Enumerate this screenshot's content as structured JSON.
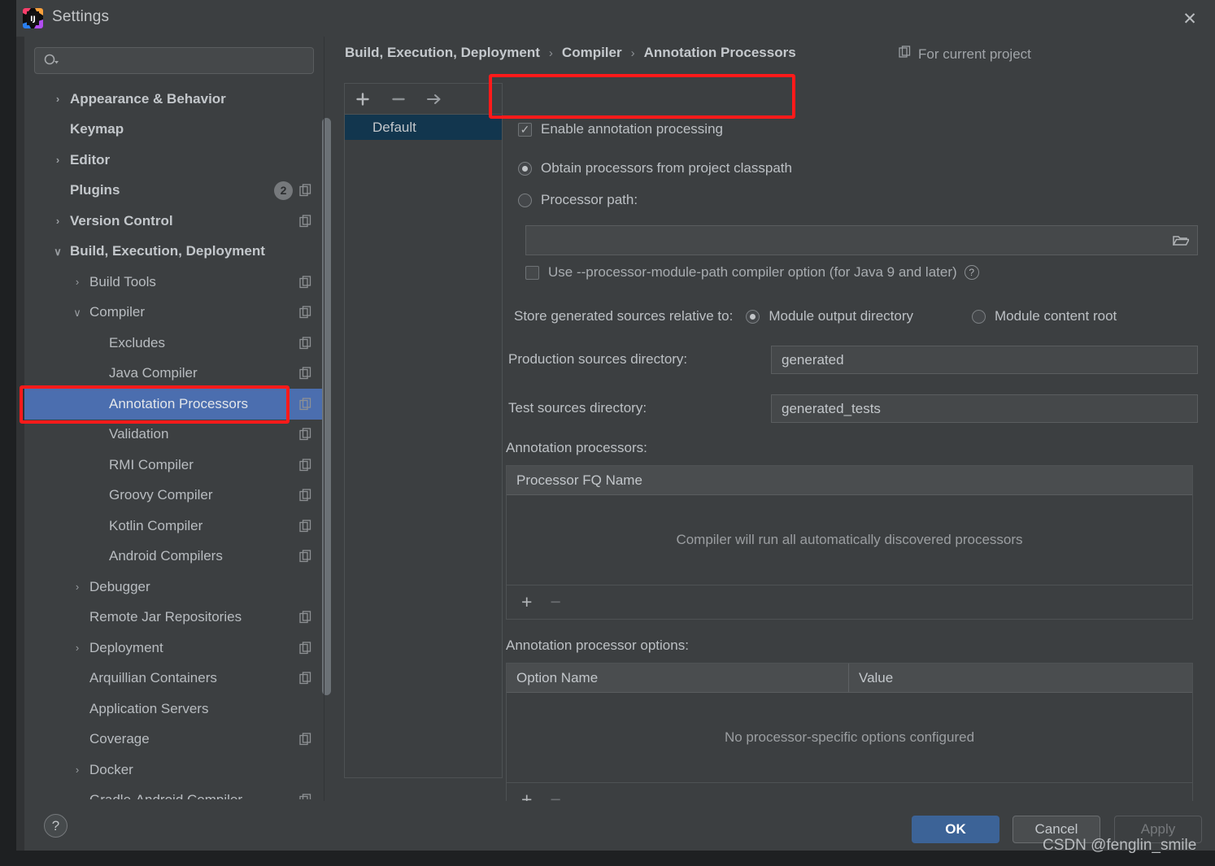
{
  "window": {
    "title": "Settings",
    "close_label": "✕",
    "logo_name": "intellij-idea-logo"
  },
  "search": {
    "placeholder": "",
    "value": ""
  },
  "sidebar": {
    "items": [
      {
        "label": "Appearance & Behavior",
        "indent": 0,
        "twisty": "›",
        "bold": true,
        "copy": false,
        "badge": null
      },
      {
        "label": "Keymap",
        "indent": 0,
        "twisty": "",
        "bold": true,
        "copy": false,
        "badge": null
      },
      {
        "label": "Editor",
        "indent": 0,
        "twisty": "›",
        "bold": true,
        "copy": false,
        "badge": null
      },
      {
        "label": "Plugins",
        "indent": 0,
        "twisty": "",
        "bold": true,
        "copy": true,
        "badge": "2"
      },
      {
        "label": "Version Control",
        "indent": 0,
        "twisty": "›",
        "bold": true,
        "copy": true,
        "badge": null
      },
      {
        "label": "Build, Execution, Deployment",
        "indent": 0,
        "twisty": "∨",
        "bold": true,
        "copy": false,
        "badge": null
      },
      {
        "label": "Build Tools",
        "indent": 1,
        "twisty": "›",
        "bold": false,
        "copy": true,
        "badge": null
      },
      {
        "label": "Compiler",
        "indent": 1,
        "twisty": "∨",
        "bold": false,
        "copy": true,
        "badge": null
      },
      {
        "label": "Excludes",
        "indent": 2,
        "twisty": "",
        "bold": false,
        "copy": true,
        "badge": null
      },
      {
        "label": "Java Compiler",
        "indent": 2,
        "twisty": "",
        "bold": false,
        "copy": true,
        "badge": null
      },
      {
        "label": "Annotation Processors",
        "indent": 2,
        "twisty": "",
        "bold": false,
        "copy": true,
        "badge": null,
        "selected": true
      },
      {
        "label": "Validation",
        "indent": 2,
        "twisty": "",
        "bold": false,
        "copy": true,
        "badge": null
      },
      {
        "label": "RMI Compiler",
        "indent": 2,
        "twisty": "",
        "bold": false,
        "copy": true,
        "badge": null
      },
      {
        "label": "Groovy Compiler",
        "indent": 2,
        "twisty": "",
        "bold": false,
        "copy": true,
        "badge": null
      },
      {
        "label": "Kotlin Compiler",
        "indent": 2,
        "twisty": "",
        "bold": false,
        "copy": true,
        "badge": null
      },
      {
        "label": "Android Compilers",
        "indent": 2,
        "twisty": "",
        "bold": false,
        "copy": true,
        "badge": null
      },
      {
        "label": "Debugger",
        "indent": 1,
        "twisty": "›",
        "bold": false,
        "copy": false,
        "badge": null
      },
      {
        "label": "Remote Jar Repositories",
        "indent": 1,
        "twisty": "",
        "bold": false,
        "copy": true,
        "badge": null
      },
      {
        "label": "Deployment",
        "indent": 1,
        "twisty": "›",
        "bold": false,
        "copy": true,
        "badge": null
      },
      {
        "label": "Arquillian Containers",
        "indent": 1,
        "twisty": "",
        "bold": false,
        "copy": true,
        "badge": null
      },
      {
        "label": "Application Servers",
        "indent": 1,
        "twisty": "",
        "bold": false,
        "copy": false,
        "badge": null
      },
      {
        "label": "Coverage",
        "indent": 1,
        "twisty": "",
        "bold": false,
        "copy": true,
        "badge": null
      },
      {
        "label": "Docker",
        "indent": 1,
        "twisty": "›",
        "bold": false,
        "copy": false,
        "badge": null
      },
      {
        "label": "Gradle-Android Compiler",
        "indent": 1,
        "twisty": "",
        "bold": false,
        "copy": true,
        "badge": null
      }
    ]
  },
  "breadcrumb": {
    "parts": [
      "Build, Execution, Deployment",
      "Compiler",
      "Annotation Processors"
    ],
    "separator": "›",
    "scope_label": "For current project"
  },
  "profiles": {
    "add_label": "+",
    "remove_label": "−",
    "move_label": "→",
    "items": [
      {
        "label": "Default",
        "selected": true
      }
    ]
  },
  "form": {
    "enable_annotation_processing": {
      "label": "Enable annotation processing",
      "checked": true
    },
    "obtain_from_classpath": {
      "label": "Obtain processors from project classpath",
      "selected": true
    },
    "processor_path": {
      "label": "Processor path:",
      "selected": false,
      "value": ""
    },
    "use_module_path": {
      "label": "Use --processor-module-path compiler option (for Java 9 and later)",
      "checked": false,
      "help": "?"
    },
    "store_generated_label": "Store generated sources relative to:",
    "store_generated_options": [
      {
        "label": "Module output directory",
        "selected": true
      },
      {
        "label": "Module content root",
        "selected": false
      }
    ],
    "production_sources": {
      "label": "Production sources directory:",
      "value": "generated"
    },
    "test_sources": {
      "label": "Test sources directory:",
      "value": "generated_tests"
    },
    "processors_section_label": "Annotation processors:",
    "processors_table": {
      "columns": [
        "Processor FQ Name"
      ],
      "empty_text": "Compiler will run all automatically discovered processors",
      "add_label": "+",
      "remove_label": "−"
    },
    "options_section_label": "Annotation processor options:",
    "options_table": {
      "columns": [
        "Option Name",
        "Value"
      ],
      "empty_text": "No processor-specific options configured",
      "add_label": "+",
      "remove_label": "−"
    }
  },
  "footer": {
    "help_label": "?",
    "ok_label": "OK",
    "cancel_label": "Cancel",
    "apply_label": "Apply"
  },
  "watermark": "CSDN @fenglin_smile",
  "colors": {
    "accent_blue": "#4b6eaf",
    "ok_button": "#3c6397",
    "selected_profile": "#12364e",
    "annotation_red": "#ff1a1a",
    "window_bg": "#3c3f41"
  }
}
